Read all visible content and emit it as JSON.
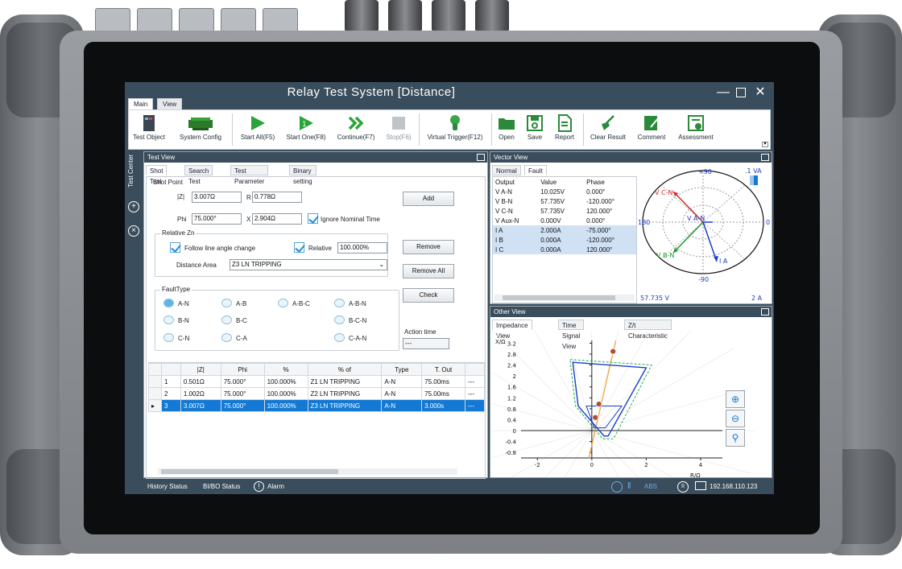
{
  "app": {
    "title": "Relay Test System  [Distance]",
    "menu_tabs": [
      "Main",
      "View"
    ]
  },
  "ribbon": [
    {
      "id": "test-object",
      "label": "Test Object",
      "icon": "device-icon"
    },
    {
      "id": "system-config",
      "label": "System Config",
      "icon": "config-icon"
    },
    {
      "id": "start-all",
      "label": "Start All(F5)",
      "icon": "play-icon"
    },
    {
      "id": "start-one",
      "label": "Start One(F8)",
      "icon": "play-one-icon"
    },
    {
      "id": "continue",
      "label": "Continue(F7)",
      "icon": "double-chevron-icon"
    },
    {
      "id": "stop",
      "label": "Stop(F6)",
      "icon": "stop-icon"
    },
    {
      "id": "virtual-trigger",
      "label": "Virtual Trigger(F12)",
      "icon": "hand-icon"
    },
    {
      "id": "open",
      "label": "Open",
      "icon": "folder-icon"
    },
    {
      "id": "save",
      "label": "Save",
      "icon": "floppy-icon"
    },
    {
      "id": "report",
      "label": "Report",
      "icon": "report-icon"
    },
    {
      "id": "clear-result",
      "label": "Clear Result",
      "icon": "broom-icon"
    },
    {
      "id": "comment",
      "label": "Comment",
      "icon": "pencil-icon"
    },
    {
      "id": "assessment",
      "label": "Assessment",
      "icon": "assessment-icon"
    }
  ],
  "side_strip": {
    "label": "Test Center"
  },
  "test_view": {
    "title": "Test View",
    "tabs": [
      "Shot Test",
      "Search Test",
      "Test Parameter",
      "Binary setting"
    ],
    "shot_point": {
      "label": "Shot Point",
      "z_label": "|Z|",
      "z_value": "3.007Ω",
      "r_label": "R",
      "r_value": "0.778Ω",
      "phi_label": "Phi",
      "phi_value": "75.000°",
      "x_label": "X",
      "x_value": "2.904Ω",
      "ignore_label": "Ignore Nominal Time"
    },
    "relative_zn": {
      "label": "Relative Zn",
      "follow_label": "Follow line angle change",
      "relative_label": "Relative",
      "relative_value": "100.000%",
      "distance_area_label": "Distance Area",
      "distance_area_value": "Z3 LN TRIPPING"
    },
    "fault_type": {
      "label": "FaultType",
      "options": [
        "A-N",
        "A-B",
        "A-B-C",
        "A-B-N",
        "B-N",
        "B-C",
        "B-C-N",
        "C-N",
        "C-A",
        "C-A-N"
      ],
      "selected": "A-N"
    },
    "buttons": {
      "add": "Add",
      "remove": "Remove",
      "remove_all": "Remove All",
      "check": "Check"
    },
    "action_time": {
      "label": "Action time",
      "value": "---"
    },
    "table": {
      "headers": [
        "",
        "|Z|",
        "Phi",
        "%",
        "% of",
        "Type",
        "T. Out"
      ],
      "rows": [
        [
          "1",
          "0.501Ω",
          "75.000°",
          "100.000%",
          "Z1 LN TRIPPING",
          "A-N",
          "75.00ms",
          "---"
        ],
        [
          "2",
          "1.002Ω",
          "75.000°",
          "100.000%",
          "Z2 LN TRIPPING",
          "A-N",
          "75.00ms",
          "---"
        ],
        [
          "3",
          "3.007Ω",
          "75.000°",
          "100.000%",
          "Z3 LN TRIPPING",
          "A-N",
          "3.000s",
          "---"
        ]
      ]
    }
  },
  "vector_view": {
    "title": "Vector View",
    "tabs": [
      "Normal",
      "Fault"
    ],
    "headers": [
      "Output",
      "Value",
      "Phase"
    ],
    "rows": [
      [
        "V A-N",
        "10.025V",
        "0.000°"
      ],
      [
        "V B-N",
        "57.735V",
        "-120.000°"
      ],
      [
        "V C-N",
        "57.735V",
        "120.000°"
      ],
      [
        "V Aux-N",
        "0.000V",
        "0.000°"
      ],
      [
        "I A",
        "2.000A",
        "-75.000°"
      ],
      [
        "I B",
        "0.000A",
        "-120.000°"
      ],
      [
        "I C",
        "0.000A",
        "120.000°"
      ]
    ],
    "diagram": {
      "scale_va": ".1 VA",
      "scale_v": "57.735 V",
      "scale_a": "2 A",
      "angle_labels": [
        "+90",
        "0",
        "-90",
        "180"
      ],
      "vectors": [
        {
          "name": "V A-N",
          "color": "#1a3cc8"
        },
        {
          "name": "V B-N",
          "color": "#1a9a2a"
        },
        {
          "name": "V C-N",
          "color": "#d42a2a"
        },
        {
          "name": "I A",
          "color": "#1a3cc8"
        }
      ]
    }
  },
  "other_view": {
    "title": "Other View",
    "tabs": [
      "Impedance View",
      "Time Signal View",
      "Z/t Characteristic"
    ],
    "chart_data": {
      "type": "scatter",
      "xlabel": "R/Ω",
      "ylabel": "X/Ω",
      "x_ticks": [
        "-2",
        "0",
        "2",
        "4"
      ],
      "y_ticks": [
        "3.2",
        "2.8",
        "2.4",
        "2",
        "1.6",
        "1.2",
        "0.8",
        "0.4",
        "0",
        "-0.4",
        "-0.8"
      ],
      "xlim": [
        -2.6,
        4.8
      ],
      "ylim": [
        -1.0,
        3.3
      ],
      "line_angle_deg": 75,
      "zone_outer": [
        [
          -0.8,
          2.6
        ],
        [
          2.2,
          2.4
        ],
        [
          0.8,
          -0.3
        ],
        [
          0.4,
          -0.3
        ],
        [
          -0.6,
          0.9
        ]
      ],
      "zone_inner": [
        [
          -0.7,
          2.5
        ],
        [
          2.0,
          2.3
        ],
        [
          0.6,
          -0.2
        ],
        [
          0.45,
          -0.2
        ],
        [
          -0.5,
          0.9
        ]
      ],
      "zone_small": [
        [
          -0.2,
          0.9
        ],
        [
          1.1,
          0.9
        ],
        [
          0.5,
          0.1
        ],
        [
          0.1,
          0.1
        ]
      ],
      "points": [
        [
          0.78,
          2.9
        ],
        [
          0.26,
          0.97
        ],
        [
          0.13,
          0.48
        ]
      ],
      "colors": {
        "zone": "#1a3cc8",
        "margin": "#22b04a",
        "line": "#f0a030",
        "point": "#b04a3a"
      }
    }
  },
  "status": {
    "history": "History Status",
    "bibo": "BI/BO Status",
    "alarm": "Alarm",
    "abs": "ABS",
    "ip": "192.168.110.123"
  }
}
